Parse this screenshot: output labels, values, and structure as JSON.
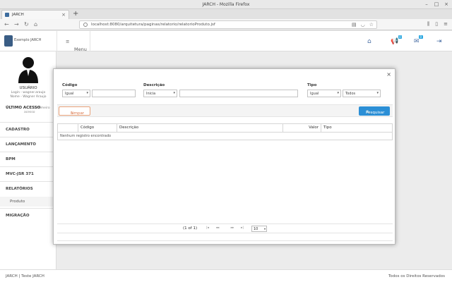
{
  "window": {
    "title": "JARCH - Mozilla Firefox"
  },
  "tab": {
    "label": "JARCH"
  },
  "url": "localhost:8080/arquitetura/paginas/relatorio/relatorioProduto.jsf",
  "app": {
    "logo_text": "Exemplo JARCH",
    "menu_label": "Menu",
    "badges": {
      "notifications": "0",
      "messages": "0"
    }
  },
  "user": {
    "title": "USUÁRIO",
    "login": "Login - wagner.araujo",
    "name": "Nome - Wagner Araujo",
    "last_access_label": "ÚLTIMO ACESSO",
    "last_access_note": "Primeiro",
    "last_access_sub": "acesso"
  },
  "sidebar": {
    "items": [
      {
        "label": "CADASTRO"
      },
      {
        "label": "LANÇAMENTO"
      },
      {
        "label": "BPM"
      },
      {
        "label": "MVC-JSR 371"
      },
      {
        "label": "RELATÓRIOS"
      }
    ],
    "sub_item": "Produto",
    "last_item": "MIGRAÇÃO"
  },
  "filters": {
    "codigo": {
      "label": "Código",
      "operator": "Igual"
    },
    "descricao": {
      "label": "Descrição",
      "operator": "Inicia"
    },
    "tipo": {
      "label": "Tipo",
      "operator": "Igual",
      "value": "Todos"
    }
  },
  "buttons": {
    "clear": "Limpar",
    "search": "Pesquisar"
  },
  "grid": {
    "columns": [
      "Código",
      "Descrição",
      "Valor",
      "Tipo"
    ],
    "empty_message": "Nenhum registro encontrado"
  },
  "paginator": {
    "page_report": "(1 of 1)",
    "first": "|◂",
    "prev": "◂◂",
    "next": "▸▸",
    "last": "▸|",
    "rows": "10"
  },
  "footer": {
    "left": "JARCH | Teste JARCH",
    "right": "Todos os Direitos Reservados"
  }
}
